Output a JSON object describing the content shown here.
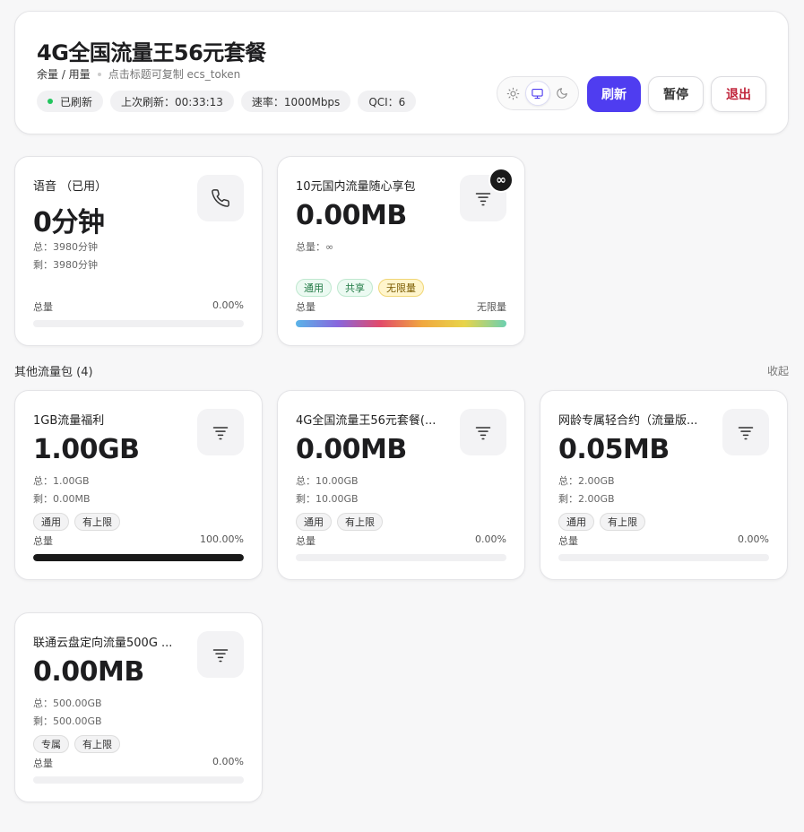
{
  "header": {
    "title": "4G全国流量王56元套餐",
    "subtitle_main": "余量 / 用量",
    "subtitle_hint": "点击标题可复制 ecs_token",
    "status": "已刷新",
    "last_refresh": "上次刷新：00:33:13",
    "rate": "速率：1000Mbps",
    "qci": "QCI：6",
    "buttons": {
      "refresh": "刷新",
      "pause": "暂停",
      "logout": "退出"
    },
    "theme_icons": [
      "sun-icon",
      "monitor-icon",
      "moon-icon"
    ],
    "theme_selected": "monitor",
    "accent_color": "#4f3df0"
  },
  "cards": [
    {
      "title": "语音 （已用）",
      "value": "0分钟",
      "line1": "总：3980分钟",
      "line2": "剩：3980分钟",
      "tags": [],
      "progress_label": "总量",
      "progress_pct": "0.00%",
      "progress_fraction": 0,
      "icon": "phone-icon"
    },
    {
      "title": "10元国内流量随心享包",
      "value": "0.00MB",
      "line1": "总量：∞",
      "tags": [
        "通用",
        "共享",
        "无限量"
      ],
      "badge": "∞",
      "progress_label": "总量",
      "progress_pct": "无限量",
      "progress_fraction": 1,
      "icon": "filter-icon"
    }
  ],
  "section": {
    "title": "其他流量包 (4)",
    "toggle": "收起"
  },
  "other_cards": [
    {
      "title": "1GB流量福利",
      "value": "1.00GB",
      "line1": "总：1.00GB",
      "line2": "剩：0.00MB",
      "tags": [
        "通用",
        "有上限"
      ],
      "progress_label": "总量",
      "progress_pct": "100.00%",
      "progress_fraction": 1,
      "icon": "filter-icon"
    },
    {
      "title": "4G全国流量王56元套餐(...",
      "value": "0.00MB",
      "line1": "总：10.00GB",
      "line2": "剩：10.00GB",
      "tags": [
        "通用",
        "有上限"
      ],
      "progress_label": "总量",
      "progress_pct": "0.00%",
      "progress_fraction": 0,
      "icon": "filter-icon"
    },
    {
      "title": "网龄专属轻合约（流量版...",
      "value": "0.05MB",
      "line1": "总：2.00GB",
      "line2": "剩：2.00GB",
      "tags": [
        "通用",
        "有上限"
      ],
      "progress_label": "总量",
      "progress_pct": "0.00%",
      "progress_fraction": 0,
      "icon": "filter-icon"
    },
    {
      "title": "联通云盘定向流量500G ...",
      "value": "0.00MB",
      "line1": "总：500.00GB",
      "line2": "剩：500.00GB",
      "tags": [
        "专属",
        "有上限"
      ],
      "progress_label": "总量",
      "progress_pct": "0.00%",
      "progress_fraction": 0,
      "icon": "filter-icon"
    }
  ]
}
